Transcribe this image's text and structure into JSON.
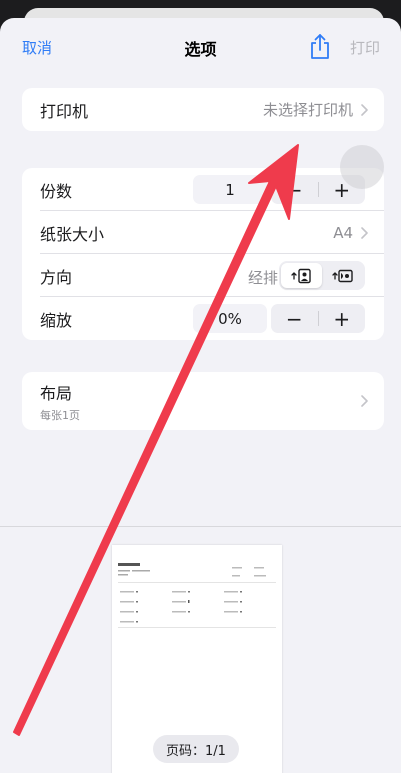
{
  "nav": {
    "cancel_label": "取消",
    "title": "选项",
    "print_label": "打印"
  },
  "printer": {
    "label": "打印机",
    "value": "未选择打印机"
  },
  "options": {
    "copies": {
      "label": "份数",
      "value": "1",
      "minus": "−",
      "plus": "+"
    },
    "paper_size": {
      "label": "纸张大小",
      "value": "A4"
    },
    "orientation": {
      "label": "方向",
      "value_partial": "经排"
    },
    "scaling": {
      "label": "缩放",
      "value": "0%",
      "minus": "−",
      "plus": "+"
    }
  },
  "layout": {
    "label": "布局",
    "subtitle": "每张1页"
  },
  "preview": {
    "page_indicator": "页码：1/1"
  },
  "colors": {
    "accent": "#2f7cf6",
    "annotation_arrow": "#ef3b4c"
  },
  "icons": {
    "share": "share-icon",
    "chevron": "chevron-right-icon",
    "portrait": "portrait-orientation-icon",
    "landscape": "landscape-orientation-icon"
  }
}
